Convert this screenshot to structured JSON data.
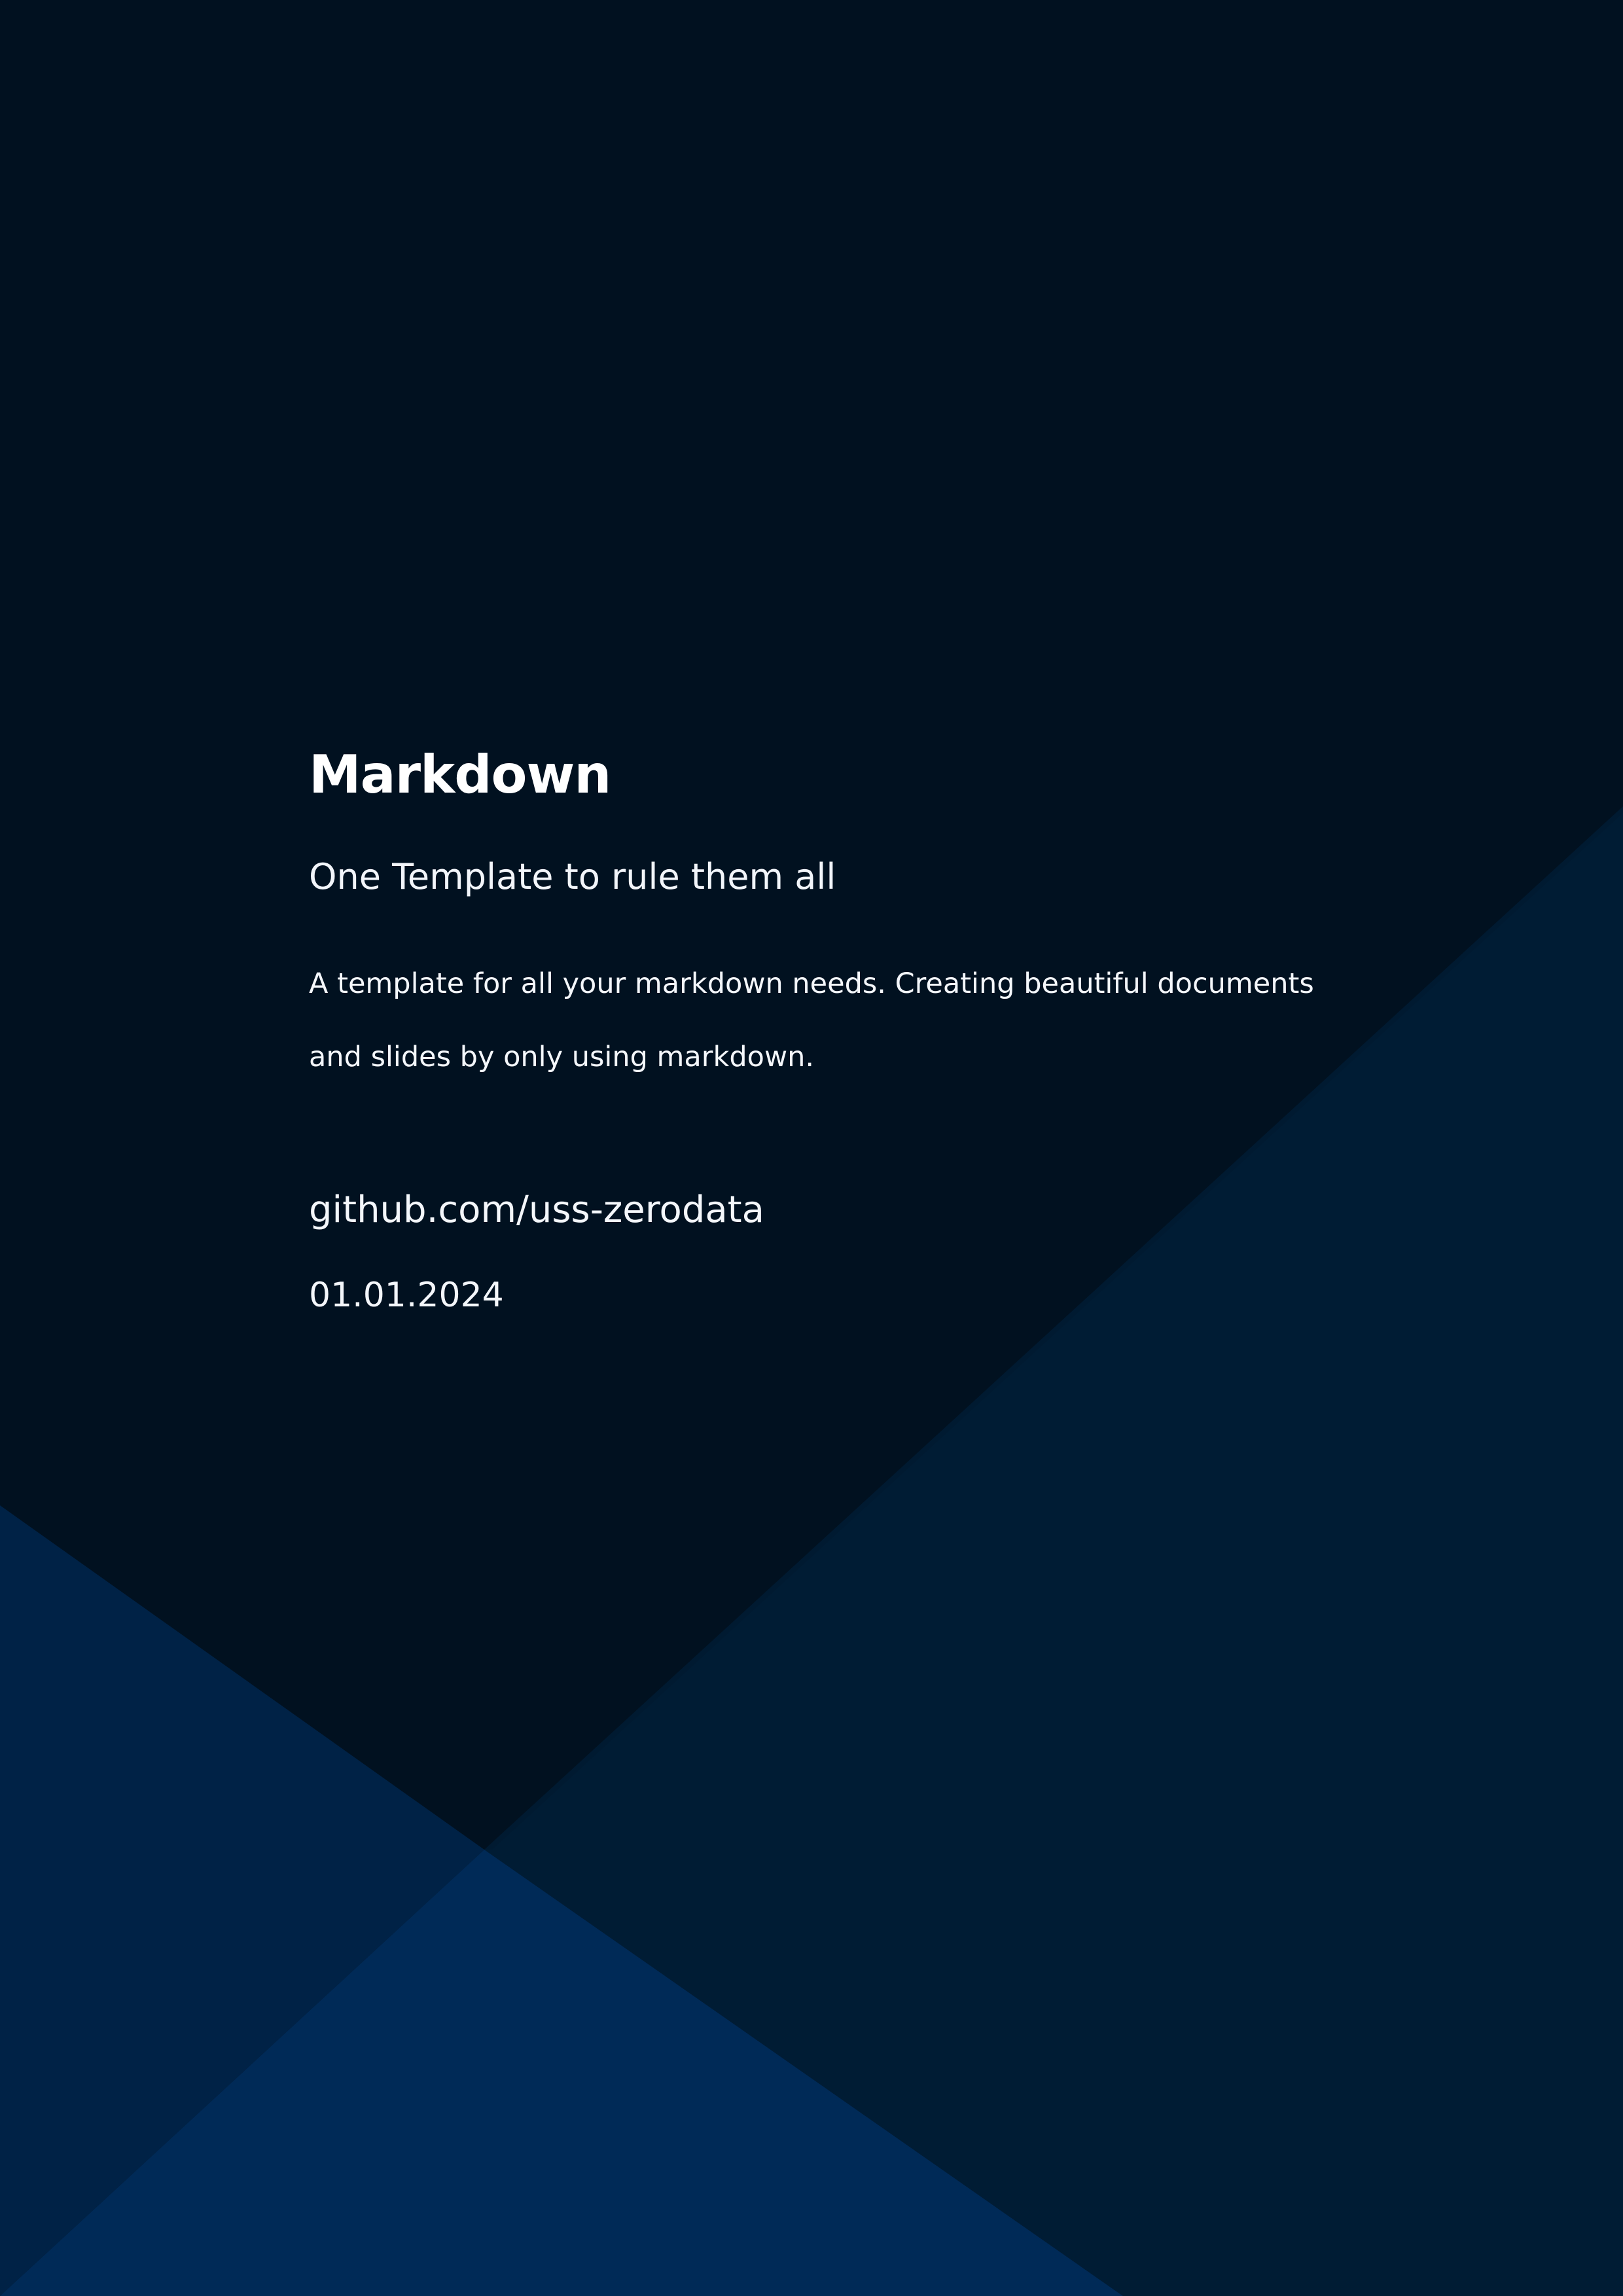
{
  "document": {
    "title": "Markdown",
    "subtitle": "One Template to rule them all",
    "description": "A template for all your markdown needs. Creating beautiful documents and slides by only using markdown.",
    "link_text": "github.com/uss-zerodata",
    "date": "01.01.2024"
  },
  "colors": {
    "background": "#011120",
    "dark_panel": "#001c34",
    "mid_panel": "#00223f",
    "accent_panel": "#002a57"
  }
}
